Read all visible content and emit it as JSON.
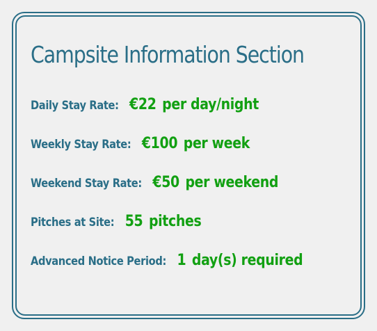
{
  "section": {
    "title": "Campsite Information Section",
    "rows": [
      {
        "label": "Daily Stay Rate:",
        "value": "€22",
        "unit": "per day/night"
      },
      {
        "label": "Weekly Stay Rate:",
        "value": "€100",
        "unit": "per week"
      },
      {
        "label": "Weekend Stay Rate:",
        "value": "€50",
        "unit": "per weekend"
      },
      {
        "label": "Pitches at Site:",
        "value": "55",
        "unit": "pitches"
      },
      {
        "label": "Advanced Notice Period:",
        "value": "1",
        "unit": "day(s) required"
      }
    ]
  },
  "colors": {
    "accent": "#2a6e87",
    "value": "#12a012",
    "background": "#f0f0f0"
  }
}
